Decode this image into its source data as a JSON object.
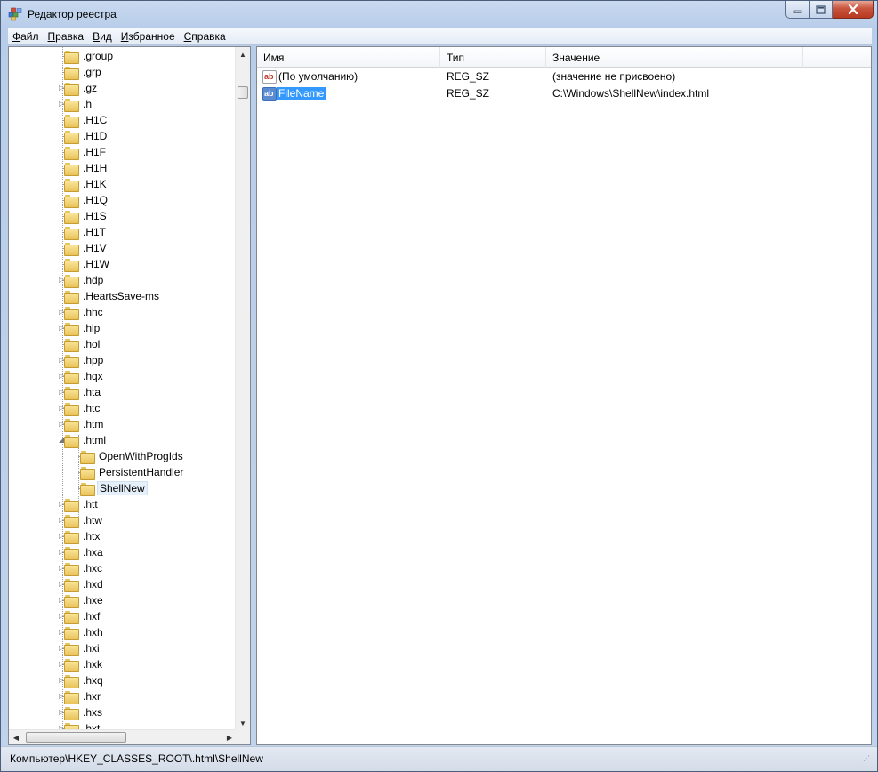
{
  "window": {
    "title": "Редактор реестра",
    "icon": "regedit-icon"
  },
  "menu": [
    "Файл",
    "Правка",
    "Вид",
    "Избранное",
    "Справка"
  ],
  "tree": {
    "items": [
      {
        "label": ".group",
        "level": 1,
        "expander": "none"
      },
      {
        "label": ".grp",
        "level": 1,
        "expander": "none"
      },
      {
        "label": ".gz",
        "level": 1,
        "expander": "collapsed"
      },
      {
        "label": ".h",
        "level": 1,
        "expander": "collapsed"
      },
      {
        "label": ".H1C",
        "level": 1,
        "expander": "none"
      },
      {
        "label": ".H1D",
        "level": 1,
        "expander": "none"
      },
      {
        "label": ".H1F",
        "level": 1,
        "expander": "none"
      },
      {
        "label": ".H1H",
        "level": 1,
        "expander": "none"
      },
      {
        "label": ".H1K",
        "level": 1,
        "expander": "none"
      },
      {
        "label": ".H1Q",
        "level": 1,
        "expander": "none"
      },
      {
        "label": ".H1S",
        "level": 1,
        "expander": "none"
      },
      {
        "label": ".H1T",
        "level": 1,
        "expander": "none"
      },
      {
        "label": ".H1V",
        "level": 1,
        "expander": "none"
      },
      {
        "label": ".H1W",
        "level": 1,
        "expander": "none"
      },
      {
        "label": ".hdp",
        "level": 1,
        "expander": "collapsed"
      },
      {
        "label": ".HeartsSave-ms",
        "level": 1,
        "expander": "none"
      },
      {
        "label": ".hhc",
        "level": 1,
        "expander": "collapsed"
      },
      {
        "label": ".hlp",
        "level": 1,
        "expander": "collapsed"
      },
      {
        "label": ".hol",
        "level": 1,
        "expander": "none"
      },
      {
        "label": ".hpp",
        "level": 1,
        "expander": "collapsed"
      },
      {
        "label": ".hqx",
        "level": 1,
        "expander": "collapsed"
      },
      {
        "label": ".hta",
        "level": 1,
        "expander": "collapsed"
      },
      {
        "label": ".htc",
        "level": 1,
        "expander": "collapsed"
      },
      {
        "label": ".htm",
        "level": 1,
        "expander": "collapsed"
      },
      {
        "label": ".html",
        "level": 1,
        "expander": "expanded"
      },
      {
        "label": "OpenWithProgIds",
        "level": 2,
        "expander": "none"
      },
      {
        "label": "PersistentHandler",
        "level": 2,
        "expander": "none"
      },
      {
        "label": "ShellNew",
        "level": 2,
        "expander": "none",
        "selected": true
      },
      {
        "label": ".htt",
        "level": 1,
        "expander": "collapsed"
      },
      {
        "label": ".htw",
        "level": 1,
        "expander": "collapsed"
      },
      {
        "label": ".htx",
        "level": 1,
        "expander": "collapsed"
      },
      {
        "label": ".hxa",
        "level": 1,
        "expander": "collapsed"
      },
      {
        "label": ".hxc",
        "level": 1,
        "expander": "collapsed"
      },
      {
        "label": ".hxd",
        "level": 1,
        "expander": "collapsed"
      },
      {
        "label": ".hxe",
        "level": 1,
        "expander": "collapsed"
      },
      {
        "label": ".hxf",
        "level": 1,
        "expander": "collapsed"
      },
      {
        "label": ".hxh",
        "level": 1,
        "expander": "collapsed"
      },
      {
        "label": ".hxi",
        "level": 1,
        "expander": "collapsed"
      },
      {
        "label": ".hxk",
        "level": 1,
        "expander": "collapsed"
      },
      {
        "label": ".hxq",
        "level": 1,
        "expander": "collapsed"
      },
      {
        "label": ".hxr",
        "level": 1,
        "expander": "collapsed"
      },
      {
        "label": ".hxs",
        "level": 1,
        "expander": "collapsed"
      },
      {
        "label": ".hxt",
        "level": 1,
        "expander": "collapsed"
      }
    ]
  },
  "values": {
    "columns": [
      "Имя",
      "Тип",
      "Значение"
    ],
    "rows": [
      {
        "name": "(По умолчанию)",
        "type": "REG_SZ",
        "data": "(значение не присвоено)",
        "selected": false
      },
      {
        "name": "FileName",
        "type": "REG_SZ",
        "data": "C:\\Windows\\ShellNew\\index.html",
        "selected": true
      }
    ]
  },
  "status": {
    "path": "Компьютер\\HKEY_CLASSES_ROOT\\.html\\ShellNew"
  },
  "colors": {
    "selection": "#3399ff",
    "titlebar": "#b8cde9",
    "close_button": "#c8543c",
    "folder": "#e8c25a"
  }
}
